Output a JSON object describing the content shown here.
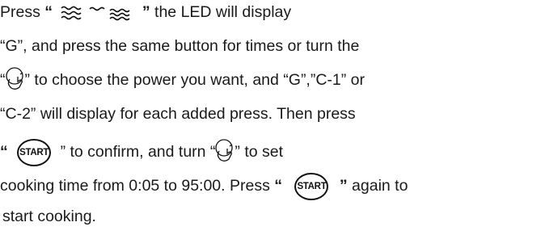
{
  "instructions": {
    "line1": {
      "press": "Press",
      "q_open": "“",
      "q_close": "”",
      "rest": "the LED will display"
    },
    "line2": {
      "text": "“G”, and press the same button for times or turn the"
    },
    "line3": {
      "q_open": "“",
      "rest": "” to choose the power you want, and “G”,”C-1” or"
    },
    "line4": {
      "text": "“C-2” will display for each added press. Then press"
    },
    "line5": {
      "q_open": "“",
      "start_label": "START",
      "mid": "” to confirm, and turn “",
      "rest": "” to set"
    },
    "line6": {
      "text_a": "cooking time from 0:05 to 95:00. Press",
      "q_open": "“",
      "start_label": "START",
      "q_close": "”",
      "text_b": "again to"
    },
    "line7": {
      "text": "start cooking."
    }
  },
  "icons": {
    "combo": "microwave-grill-combo-icon",
    "knob": "rotary-knob-hand-icon",
    "start": "start-button-icon"
  },
  "colors": {
    "text": "#1a1a1a",
    "icon": "#111111"
  }
}
